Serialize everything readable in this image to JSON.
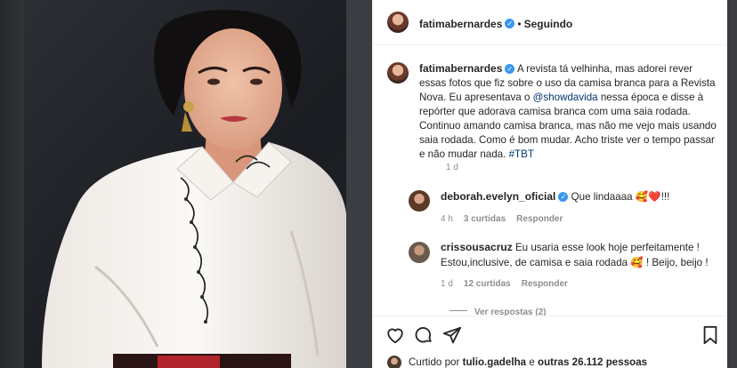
{
  "header": {
    "username": "fatimabernardes",
    "separator": "•",
    "follow_status": "Seguindo"
  },
  "caption": {
    "username": "fatimabernardes",
    "text_before_mention": "A revista tá velhinha, mas adorei rever essas fotos que fiz sobre o uso da camisa branca para a Revista Nova. Eu apresentava o ",
    "mention": "@showdavida",
    "text_after_mention": " nessa época e disse à repórter que adorava camisa branca com uma saia rodada. Continuo amando camisa branca, mas não me vejo mais usando saia rodada. Como é bom mudar. Acho triste ver o tempo passar e não mudar nada. ",
    "hashtag": "#TBT",
    "time": "1 d"
  },
  "comments": [
    {
      "username": "deborah.evelyn_oficial",
      "text": "Que lindaaaa 🥰❤️!!!",
      "time": "4 h",
      "likes": "3 curtidas",
      "reply_label": "Responder"
    },
    {
      "username": "crissousacruz",
      "text": "Eu usaria esse look hoje perfeitamente ! Estou,inclusive, de camisa e saia rodada 🥰 ! Beijo, beijo !",
      "time": "1 d",
      "likes": "12 curtidas",
      "reply_label": "Responder",
      "view_replies": "Ver respostas (2)"
    }
  ],
  "likes": {
    "prefix": "Curtido por",
    "user": "tulio.gadelha",
    "middle": "e",
    "count": "outras 26.112 pessoas"
  },
  "icons": {
    "like": "heart-icon",
    "comment": "comment-icon",
    "share": "share-icon",
    "save": "bookmark-icon"
  },
  "colors": {
    "verified": "#3897f0",
    "link": "#00376b",
    "secondary_text": "#8e8e8e"
  }
}
